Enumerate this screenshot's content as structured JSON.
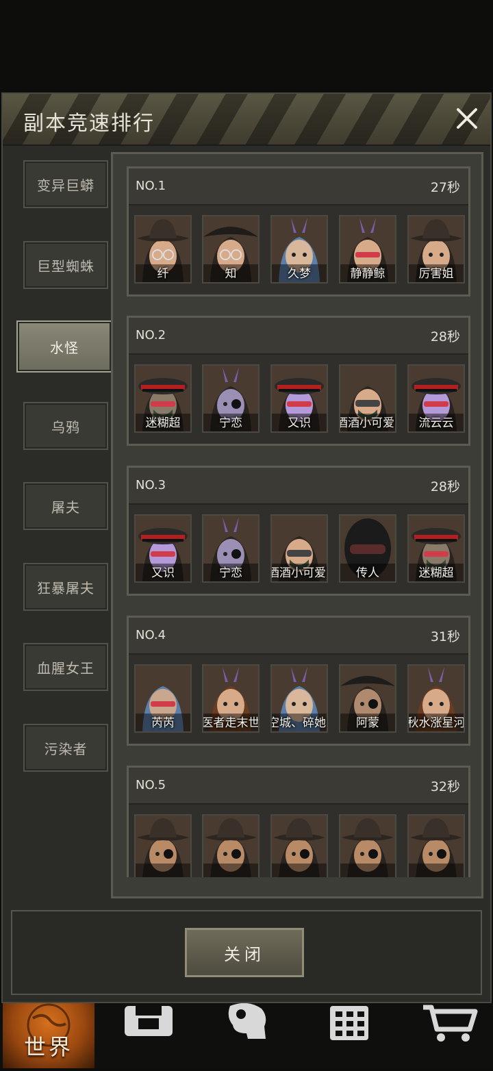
{
  "header": {
    "title": "副本竞速排行"
  },
  "tabs": [
    {
      "label": "变异巨蟒",
      "active": false
    },
    {
      "label": "巨型蜘蛛",
      "active": false
    },
    {
      "label": "水怪",
      "active": true
    },
    {
      "label": "乌鸦",
      "active": false
    },
    {
      "label": "屠夫",
      "active": false
    },
    {
      "label": "狂暴屠夫",
      "active": false
    },
    {
      "label": "血腥女王",
      "active": false
    },
    {
      "label": "污染者",
      "active": false
    }
  ],
  "rankings": [
    {
      "rank": "NO.1",
      "time": "27秒",
      "members": [
        {
          "name": "纤",
          "avatar": "female-hat-glasses"
        },
        {
          "name": "知",
          "avatar": "female-pirate-glasses"
        },
        {
          "name": "久梦",
          "avatar": "bunny-blue-hair"
        },
        {
          "name": "静静鲸",
          "avatar": "bunny-red-visor"
        },
        {
          "name": "厉害姐",
          "avatar": "female-hat"
        }
      ]
    },
    {
      "rank": "NO.2",
      "time": "28秒",
      "members": [
        {
          "name": "迷糊超",
          "avatar": "officer-gasmask"
        },
        {
          "name": "宁恋",
          "avatar": "bunny-eyepatch-purple"
        },
        {
          "name": "又识",
          "avatar": "officer-purple"
        },
        {
          "name": "酒酒小可爱暖",
          "avatar": "male-goggles-mask"
        },
        {
          "name": "流云云",
          "avatar": "officer-purple"
        }
      ]
    },
    {
      "rank": "NO.3",
      "time": "28秒",
      "members": [
        {
          "name": "又识",
          "avatar": "officer-purple"
        },
        {
          "name": "宁恋",
          "avatar": "bunny-eyepatch-purple"
        },
        {
          "name": "酒酒小可爱暖",
          "avatar": "male-goggles-mask"
        },
        {
          "name": "传人",
          "avatar": "helmet"
        },
        {
          "name": "迷糊超",
          "avatar": "officer-gasmask"
        }
      ]
    },
    {
      "rank": "NO.4",
      "time": "31秒",
      "members": [
        {
          "name": "芮芮",
          "avatar": "blue-hair-visor"
        },
        {
          "name": "医者走末世",
          "avatar": "bunny-brown-hair"
        },
        {
          "name": "空城、碎她心",
          "avatar": "bunny-blue-hair"
        },
        {
          "name": "阿蒙",
          "avatar": "pirate-eyepatch"
        },
        {
          "name": "秋水涨星河",
          "avatar": "bunny-brown-hair"
        }
      ]
    },
    {
      "rank": "NO.5",
      "time": "32秒",
      "members": [
        {
          "name": "",
          "avatar": "cowboy-eyepatch"
        },
        {
          "name": "",
          "avatar": "cowboy-eyepatch"
        },
        {
          "name": "",
          "avatar": "cowboy-eyepatch"
        },
        {
          "name": "",
          "avatar": "cowboy-eyepatch"
        },
        {
          "name": "",
          "avatar": "cowboy-eyepatch"
        }
      ]
    }
  ],
  "footer": {
    "close_label": "关闭"
  },
  "bottom_nav": [
    {
      "label": "世界",
      "icon": "globe-icon",
      "active": true
    },
    {
      "label": "",
      "icon": "backpack-icon",
      "active": false
    },
    {
      "label": "",
      "icon": "head-gear-icon",
      "active": false
    },
    {
      "label": "",
      "icon": "building-icon",
      "active": false
    },
    {
      "label": "",
      "icon": "cart-icon",
      "active": false
    }
  ]
}
